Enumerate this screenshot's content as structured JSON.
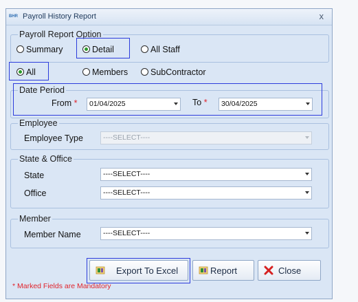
{
  "window": {
    "title": "Payroll History Report",
    "app_icon_text": "BHR",
    "close_glyph": "x"
  },
  "report_option": {
    "legend": "Payroll Report Option",
    "options": [
      {
        "label": "Summary",
        "selected": false
      },
      {
        "label": "Detail",
        "selected": true
      },
      {
        "label": "All Staff",
        "selected": false
      }
    ]
  },
  "staff_type": {
    "options": [
      {
        "label": "All",
        "selected": true
      },
      {
        "label": "Members",
        "selected": false
      },
      {
        "label": "SubContractor",
        "selected": false
      }
    ]
  },
  "date_period": {
    "legend": "Date Period",
    "from_label": "From",
    "from_value": "01/04/2025",
    "to_label": "To",
    "to_value": "30/04/2025",
    "required_mark": "*"
  },
  "employee": {
    "legend": "Employee",
    "type_label": "Employee Type",
    "type_value": "----SELECT----",
    "disabled": true
  },
  "state_office": {
    "legend": "State & Office",
    "state_label": "State",
    "state_value": "----SELECT----",
    "office_label": "Office",
    "office_value": "----SELECT----"
  },
  "member": {
    "legend": "Member",
    "name_label": "Member Name",
    "name_value": "----SELECT----"
  },
  "buttons": {
    "export": "Export To Excel",
    "report": "Report",
    "close": "Close"
  },
  "footer_note": "* Marked Fields are Mandatory",
  "colors": {
    "highlight": "#2b3bdc",
    "required": "#e0232b",
    "radio_selected": "#2a9a2a",
    "close_icon": "#d62020"
  }
}
